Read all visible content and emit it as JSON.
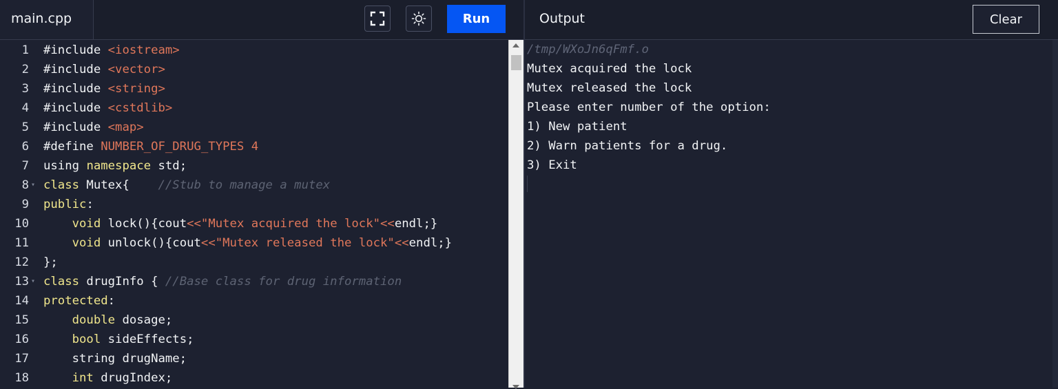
{
  "editor": {
    "file_tab": "main.cpp",
    "fullscreen_icon": "fullscreen-icon",
    "theme_icon": "sun-icon",
    "run_label": "Run",
    "code_lines": [
      {
        "n": "1",
        "fold": false,
        "tokens": [
          {
            "t": "#include ",
            "c": "plain"
          },
          {
            "t": "<iostream>",
            "c": "str"
          }
        ]
      },
      {
        "n": "2",
        "fold": false,
        "tokens": [
          {
            "t": "#include ",
            "c": "plain"
          },
          {
            "t": "<vector>",
            "c": "str"
          }
        ]
      },
      {
        "n": "3",
        "fold": false,
        "tokens": [
          {
            "t": "#include ",
            "c": "plain"
          },
          {
            "t": "<string>",
            "c": "str"
          }
        ]
      },
      {
        "n": "4",
        "fold": false,
        "tokens": [
          {
            "t": "#include ",
            "c": "plain"
          },
          {
            "t": "<cstdlib>",
            "c": "str"
          }
        ]
      },
      {
        "n": "5",
        "fold": false,
        "tokens": [
          {
            "t": "#include ",
            "c": "plain"
          },
          {
            "t": "<map>",
            "c": "str"
          }
        ]
      },
      {
        "n": "6",
        "fold": false,
        "tokens": [
          {
            "t": "#define ",
            "c": "plain"
          },
          {
            "t": "NUMBER_OF_DRUG_TYPES 4",
            "c": "str"
          }
        ]
      },
      {
        "n": "7",
        "fold": false,
        "tokens": [
          {
            "t": "using",
            "c": "plain"
          },
          {
            "t": " ",
            "c": "plain"
          },
          {
            "t": "namespace",
            "c": "kw"
          },
          {
            "t": " std;",
            "c": "plain"
          }
        ]
      },
      {
        "n": "8",
        "fold": true,
        "tokens": [
          {
            "t": "class",
            "c": "kw"
          },
          {
            "t": " Mutex{    ",
            "c": "plain"
          },
          {
            "t": "//Stub to manage a mutex",
            "c": "com"
          }
        ]
      },
      {
        "n": "9",
        "fold": false,
        "tokens": [
          {
            "t": "public",
            "c": "kw"
          },
          {
            "t": ":",
            "c": "plain"
          }
        ]
      },
      {
        "n": "10",
        "fold": false,
        "tokens": [
          {
            "t": "    ",
            "c": "plain"
          },
          {
            "t": "void",
            "c": "kw"
          },
          {
            "t": " lock(){cout",
            "c": "plain"
          },
          {
            "t": "<<\"Mutex acquired the lock\"<<",
            "c": "str"
          },
          {
            "t": "endl;}",
            "c": "plain"
          }
        ]
      },
      {
        "n": "11",
        "fold": false,
        "tokens": [
          {
            "t": "    ",
            "c": "plain"
          },
          {
            "t": "void",
            "c": "kw"
          },
          {
            "t": " unlock(){cout",
            "c": "plain"
          },
          {
            "t": "<<\"Mutex released the lock\"<<",
            "c": "str"
          },
          {
            "t": "endl;}",
            "c": "plain"
          }
        ]
      },
      {
        "n": "12",
        "fold": false,
        "tokens": [
          {
            "t": "};",
            "c": "plain"
          }
        ]
      },
      {
        "n": "13",
        "fold": true,
        "tokens": [
          {
            "t": "class",
            "c": "kw"
          },
          {
            "t": " drugInfo { ",
            "c": "plain"
          },
          {
            "t": "//Base class for drug information",
            "c": "com"
          }
        ]
      },
      {
        "n": "14",
        "fold": false,
        "tokens": [
          {
            "t": "protected",
            "c": "kw"
          },
          {
            "t": ":",
            "c": "plain"
          }
        ]
      },
      {
        "n": "15",
        "fold": false,
        "tokens": [
          {
            "t": "    ",
            "c": "plain"
          },
          {
            "t": "double",
            "c": "kw"
          },
          {
            "t": " dosage;",
            "c": "plain"
          }
        ]
      },
      {
        "n": "16",
        "fold": false,
        "tokens": [
          {
            "t": "    ",
            "c": "plain"
          },
          {
            "t": "bool",
            "c": "kw"
          },
          {
            "t": " sideEffects;",
            "c": "plain"
          }
        ]
      },
      {
        "n": "17",
        "fold": false,
        "tokens": [
          {
            "t": "    string drugName;",
            "c": "plain"
          }
        ]
      },
      {
        "n": "18",
        "fold": false,
        "tokens": [
          {
            "t": "    ",
            "c": "plain"
          },
          {
            "t": "int",
            "c": "kw"
          },
          {
            "t": " drugIndex;",
            "c": "plain"
          }
        ]
      }
    ]
  },
  "output": {
    "title": "Output",
    "clear_label": "Clear",
    "path": "/tmp/WXoJn6qFmf.o",
    "lines": [
      "Mutex acquired the lock",
      "Mutex released the lock",
      "Please enter number of the option:",
      "1) New patient",
      "2) Warn patients for a drug.",
      "3) Exit"
    ]
  },
  "colors": {
    "background": "#1d2130",
    "run_button": "#0556f3",
    "keyword": "#f0e68c",
    "string": "#e0775a",
    "comment": "#5d6373"
  }
}
